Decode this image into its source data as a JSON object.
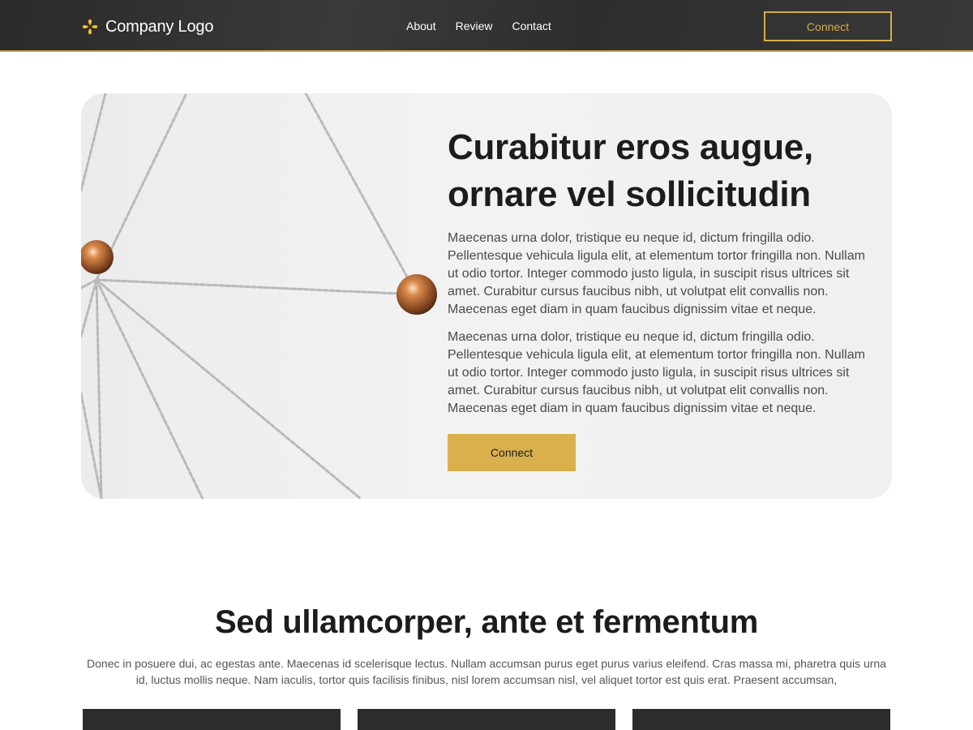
{
  "header": {
    "logo_text": "Company Logo",
    "logo_icon": "flower-logo-icon",
    "nav": [
      {
        "label": "About"
      },
      {
        "label": "Review"
      },
      {
        "label": "Contact"
      }
    ],
    "cta_label": "Connect"
  },
  "hero": {
    "title": "Curabitur eros augue, ornare vel sollicitudin",
    "paragraphs": [
      "Maecenas urna dolor, tristique eu neque id, dictum fringilla odio. Pellentesque vehicula ligula elit, at elementum tortor fringilla non. Nullam ut odio tortor. Integer commodo justo ligula, in suscipit risus ultrices sit amet. Curabitur cursus faucibus nibh, ut volutpat elit convallis non. Maecenas eget diam in quam faucibus dignissim vitae et neque.",
      "Maecenas urna dolor, tristique eu neque id, dictum fringilla odio. Pellentesque vehicula ligula elit, at elementum tortor fringilla non. Nullam ut odio tortor. Integer commodo justo ligula, in suscipit risus ultrices sit amet. Curabitur cursus faucibus nibh, ut volutpat elit convallis non. Maecenas eget diam in quam faucibus dignissim vitae et neque."
    ],
    "button_label": "Connect"
  },
  "section": {
    "title": "Sed ullamcorper, ante et fermentum",
    "description": "Donec in posuere dui, ac egestas ante. Maecenas id scelerisque lectus. Nullam accumsan purus eget purus varius eleifend. Cras massa mi, pharetra quis urna id, luctus mollis neque. Nam iaculis, tortor quis facilisis finibus, nisl lorem accumsan nisl, vel aliquet tortor est quis erat. Praesent accumsan,"
  },
  "colors": {
    "accent": "#d9b04c",
    "header_bg": "#2e2e2e",
    "card_bg": "#2c2c2c"
  }
}
